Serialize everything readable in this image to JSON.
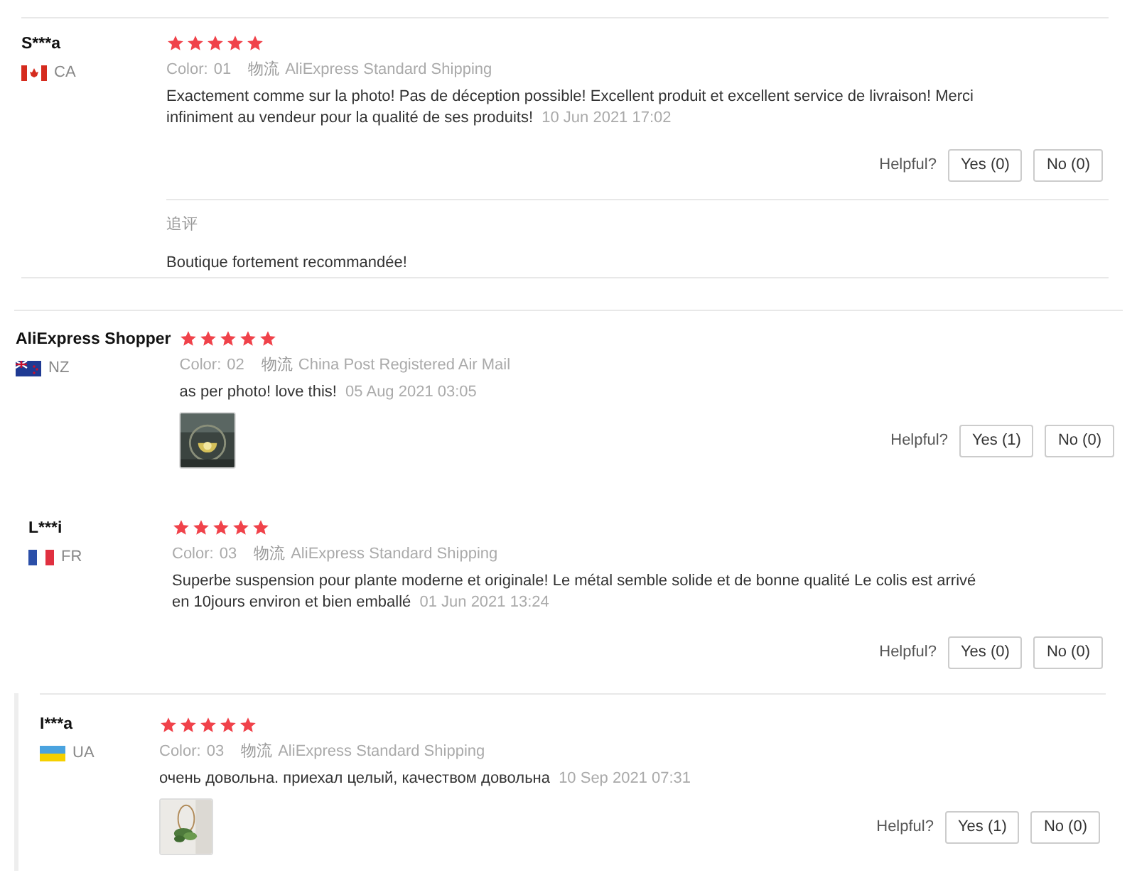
{
  "reviews": [
    {
      "name": "S***a",
      "flag": {
        "kind": "ca"
      },
      "country": "CA",
      "stars": 5,
      "color_label": "Color:",
      "color_value": "01",
      "shipping_label": "物流",
      "shipping": "AliExpress Standard Shipping",
      "text": "Exactement comme sur la photo! Pas de déception possible! Excellent produit et excellent service de livraison! Merci infiniment au vendeur pour la qualité de ses produits!",
      "date": "10 Jun 2021 17:02",
      "helpful_label": "Helpful?",
      "yes": "Yes (0)",
      "no": "No (0)",
      "followup": {
        "label": "追评",
        "text": "Boutique fortement recommandée!"
      }
    },
    {
      "name": "AliExpress Shopper",
      "flag": {
        "kind": "nz"
      },
      "country": "NZ",
      "stars": 5,
      "color_label": "Color:",
      "color_value": "02",
      "shipping_label": "物流",
      "shipping": "China Post Registered Air Mail",
      "text": "as per photo! love this!",
      "date": "05 Aug 2021 03:05",
      "images": [
        {
          "kind": "picture"
        }
      ],
      "helpful_label": "Helpful?",
      "yes": "Yes (1)",
      "no": "No (0)"
    },
    {
      "name": "L***i",
      "flag": {
        "kind": "fr"
      },
      "country": "FR",
      "stars": 5,
      "color_label": "Color:",
      "color_value": "03",
      "shipping_label": "物流",
      "shipping": "AliExpress Standard Shipping",
      "text": "Superbe suspension pour plante moderne et originale! Le métal semble solide et de bonne qualité Le colis est arrivé en 10jours environ et bien emballé",
      "date": "01 Jun 2021 13:24",
      "helpful_label": "Helpful?",
      "yes": "Yes (0)",
      "no": "No (0)"
    },
    {
      "name": "I***a",
      "flag": {
        "kind": "ua"
      },
      "country": "UA",
      "stars": 5,
      "color_label": "Color:",
      "color_value": "03",
      "shipping_label": "物流",
      "shipping": "AliExpress Standard Shipping",
      "text": "очень довольна. приехал целый, качеством довольна",
      "date": "10 Sep 2021 07:31",
      "images": [
        {
          "kind": "picture"
        }
      ],
      "helpful_label": "Helpful?",
      "yes": "Yes (1)",
      "no": "No (0)"
    }
  ]
}
